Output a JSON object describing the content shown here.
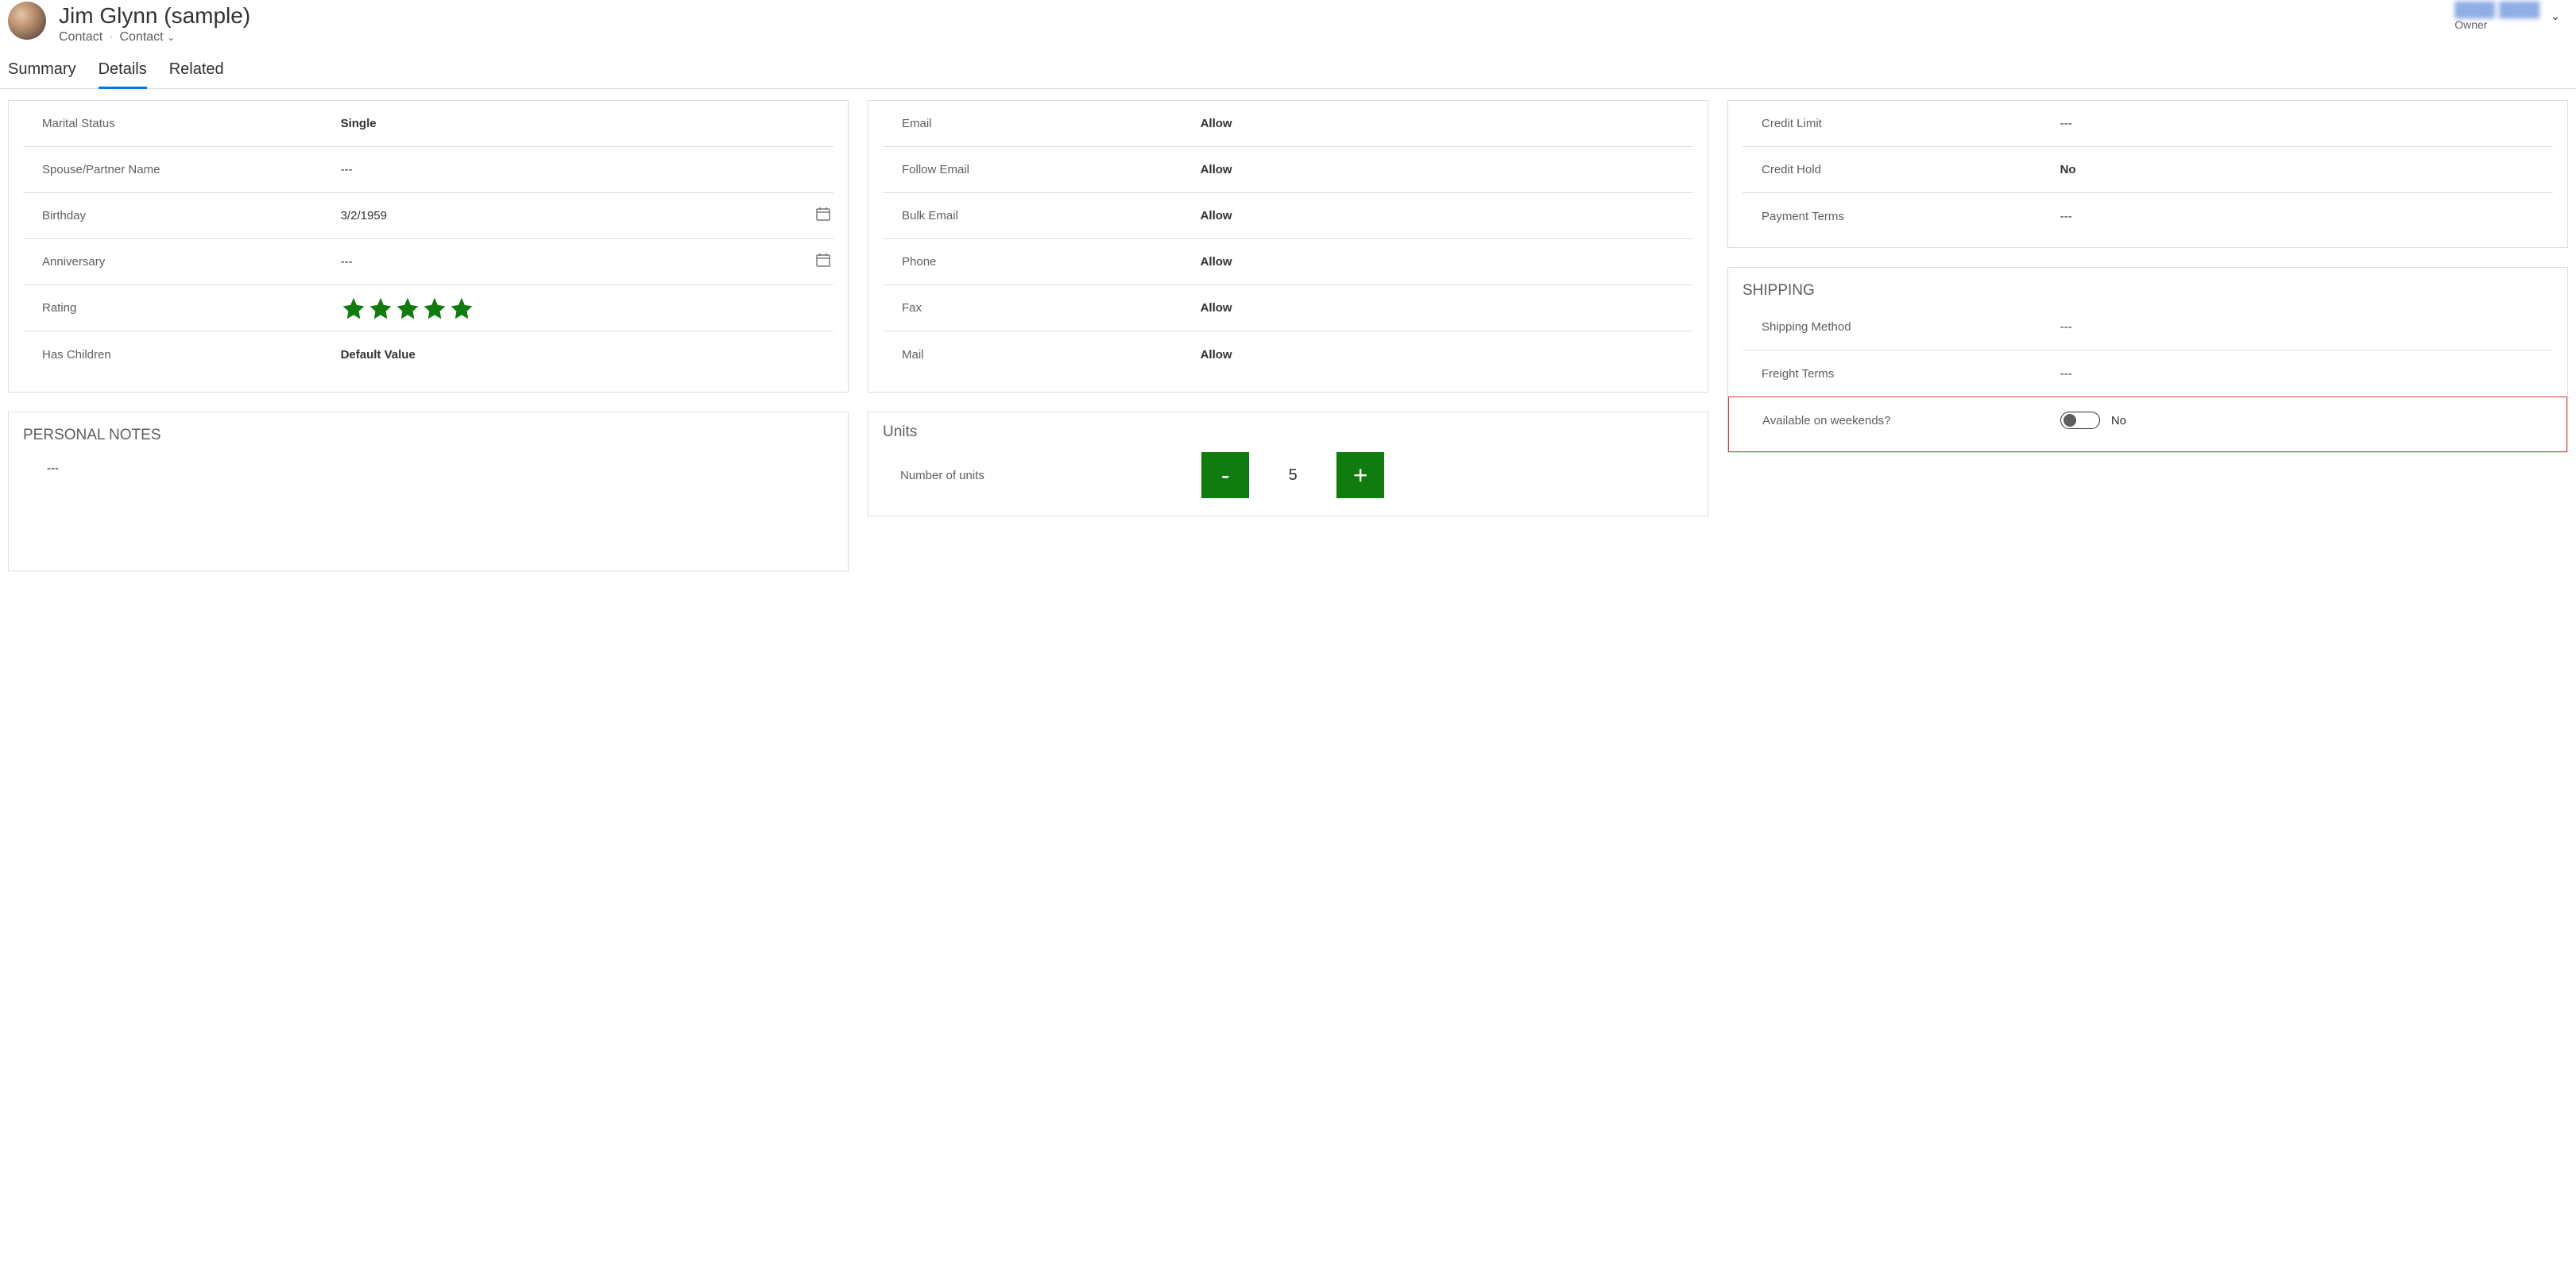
{
  "header": {
    "title": "Jim Glynn (sample)",
    "entity": "Contact",
    "form": "Contact",
    "owner_label": "Owner",
    "owner_name": "████ ████"
  },
  "tabs": {
    "summary": "Summary",
    "details": "Details",
    "related": "Related",
    "active": "details"
  },
  "personal": {
    "marital_status_label": "Marital Status",
    "marital_status_value": "Single",
    "spouse_label": "Spouse/Partner Name",
    "spouse_value": "---",
    "birthday_label": "Birthday",
    "birthday_value": "3/2/1959",
    "anniversary_label": "Anniversary",
    "anniversary_value": "---",
    "rating_label": "Rating",
    "rating_value": 5,
    "has_children_label": "Has Children",
    "has_children_value": "Default Value"
  },
  "notes": {
    "title": "PERSONAL NOTES",
    "body": "---"
  },
  "contact_prefs": {
    "email_label": "Email",
    "email_value": "Allow",
    "follow_email_label": "Follow Email",
    "follow_email_value": "Allow",
    "bulk_email_label": "Bulk Email",
    "bulk_email_value": "Allow",
    "phone_label": "Phone",
    "phone_value": "Allow",
    "fax_label": "Fax",
    "fax_value": "Allow",
    "mail_label": "Mail",
    "mail_value": "Allow"
  },
  "units": {
    "title": "Units",
    "label": "Number of units",
    "value": "5",
    "minus": "-",
    "plus": "+"
  },
  "billing": {
    "credit_limit_label": "Credit Limit",
    "credit_limit_value": "---",
    "credit_hold_label": "Credit Hold",
    "credit_hold_value": "No",
    "payment_terms_label": "Payment Terms",
    "payment_terms_value": "---"
  },
  "shipping": {
    "title": "SHIPPING",
    "method_label": "Shipping Method",
    "method_value": "---",
    "freight_label": "Freight Terms",
    "freight_value": "---",
    "weekends_label": "Available on weekends?",
    "weekends_value": "No"
  }
}
